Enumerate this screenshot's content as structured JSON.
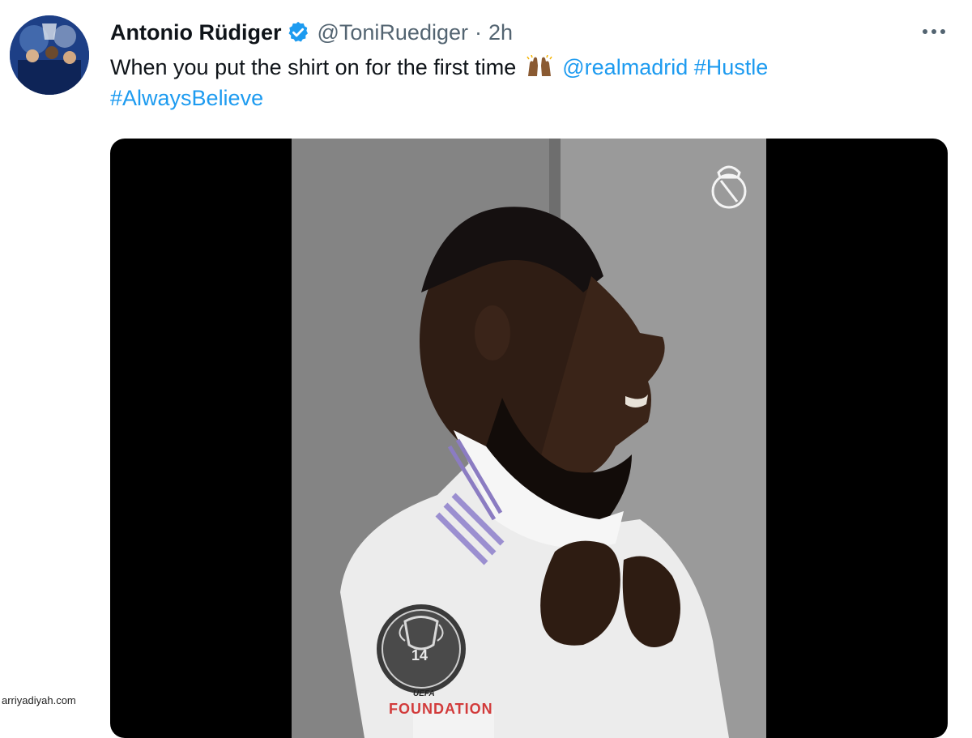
{
  "tweet": {
    "author_name": "Antonio Rüdiger",
    "handle": "@ToniRuediger",
    "separator": "·",
    "time": "2h",
    "text_before": "When you put the shirt on for the first time",
    "mention": "@realmadrid",
    "hashtag_1": "#Hustle",
    "hashtag_2": "#AlwaysBelieve",
    "link_color": "#1d9bf0",
    "verified_color": "#1d9bf0"
  },
  "media": {
    "patch_number": "14",
    "patch_brand_top": "UEFA",
    "patch_brand": "FOUNDATION"
  },
  "watermark": "arriyadiyah.com",
  "icons": [
    "verified-badge-icon",
    "more-options-icon",
    "raising-hands-emoji-icon",
    "real-madrid-crest-icon"
  ]
}
